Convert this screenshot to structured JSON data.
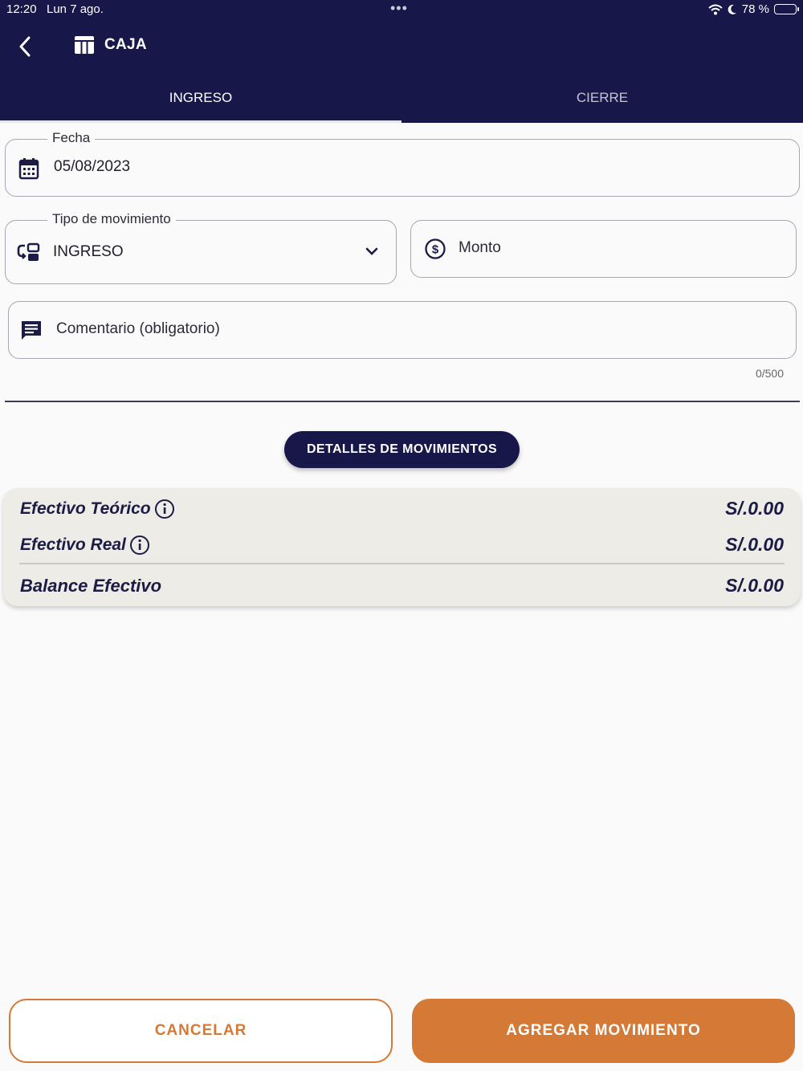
{
  "status_bar": {
    "time": "12:20",
    "date": "Lun 7 ago.",
    "dots": "•••",
    "battery": "78 %",
    "battery_level": 0.78
  },
  "header": {
    "back_icon": "chevron-left-icon",
    "title_icon": "table-icon",
    "title": "CAJA"
  },
  "tabs": [
    {
      "label": "INGRESO",
      "active": true
    },
    {
      "label": "CIERRE",
      "active": false
    }
  ],
  "form": {
    "fecha": {
      "label": "Fecha",
      "value": "05/08/2023",
      "icon": "calendar-icon"
    },
    "tipo": {
      "label": "Tipo de movimiento",
      "value": "INGRESO",
      "icon": "swap-icon"
    },
    "monto": {
      "placeholder": "Monto",
      "icon": "dollar-circle-icon"
    },
    "comentario": {
      "placeholder": "Comentario (obligatorio)",
      "icon": "comment-icon",
      "counter": "0/500"
    }
  },
  "details_button": "DETALLES DE MOVIMIENTOS",
  "summary": {
    "teorico": {
      "label": "Efectivo Teórico",
      "value": "S/.0.00"
    },
    "real": {
      "label": "Efectivo Real",
      "value": "S/.0.00"
    },
    "balance": {
      "label": "Balance Efectivo",
      "value": "S/.0.00"
    }
  },
  "actions": {
    "cancel": "CANCELAR",
    "add": "AGREGAR MOVIMIENTO"
  },
  "colors": {
    "primary": "#17174a",
    "accent": "#d47936",
    "summary_bg": "#edece7"
  }
}
